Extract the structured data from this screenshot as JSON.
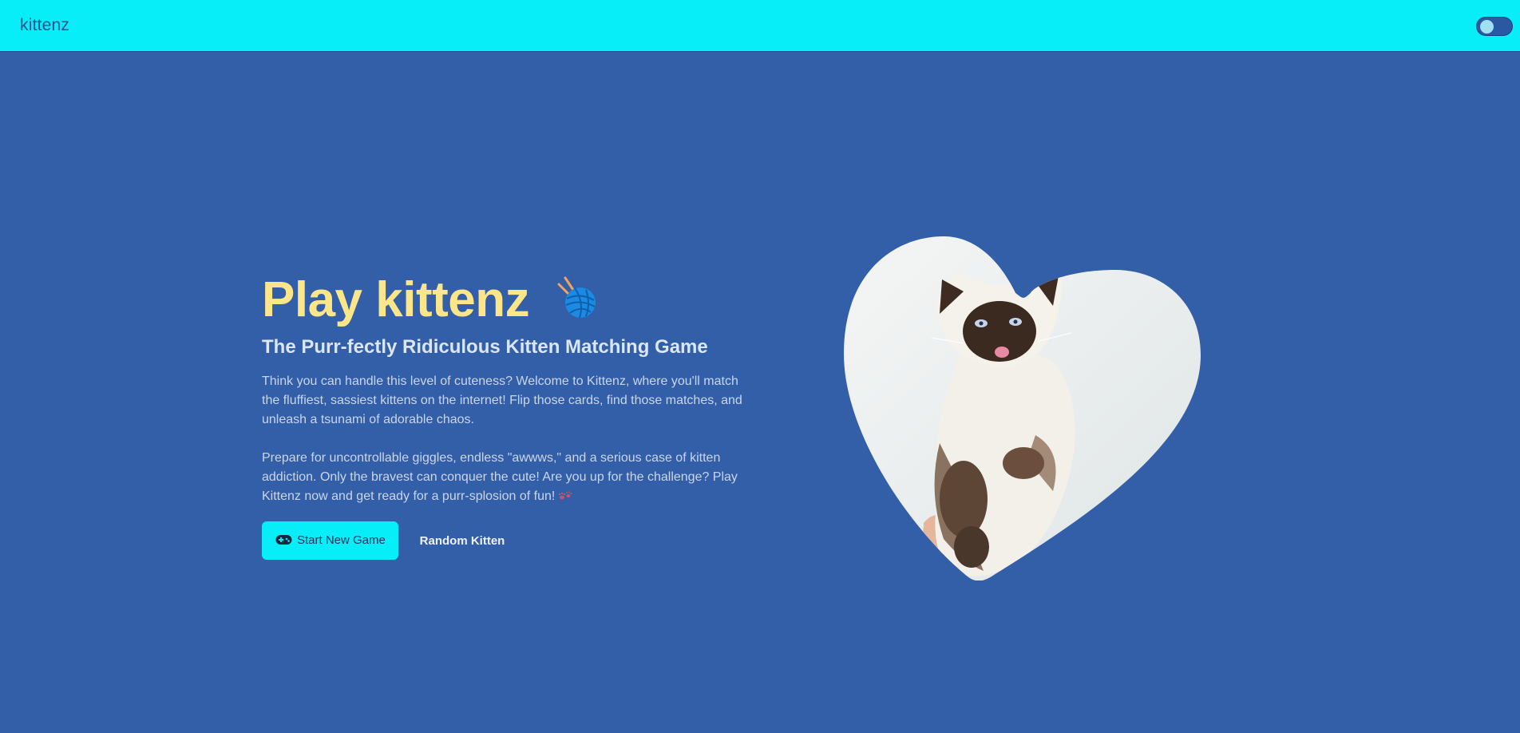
{
  "nav": {
    "brand": "kittenz",
    "theme_toggle": "off"
  },
  "hero": {
    "title": "Play kittenz",
    "title_icon": "yarn-ball-icon",
    "subtitle": "The Purr-fectly Ridiculous Kitten Matching Game",
    "paragraph_1": "Think you can handle this level of cuteness? Welcome to Kittenz, where you'll match the fluffiest, sassiest kittens on the internet! Flip those cards, find those matches, and unleash a tsunami of adorable chaos.",
    "paragraph_2": "Prepare for uncontrollable giggles, endless \"awwws,\" and a serious case of kitten addiction. Only the bravest can conquer the cute! Are you up for the challenge? Play Kittenz now and get ready for a purr-splosion of fun!",
    "paragraph_2_icon": "paw-prints-icon"
  },
  "actions": {
    "start_label": "Start New Game",
    "start_icon": "gamepad-icon",
    "random_label": "Random Kitten"
  },
  "image": {
    "subject": "fluffy Himalayan kitten photo in a heart-shaped frame",
    "shape": "heart"
  },
  "colors": {
    "navbar": "#08eef8",
    "background": "#335ea8",
    "title": "#fde68a",
    "primary_button": "#08eef8"
  }
}
